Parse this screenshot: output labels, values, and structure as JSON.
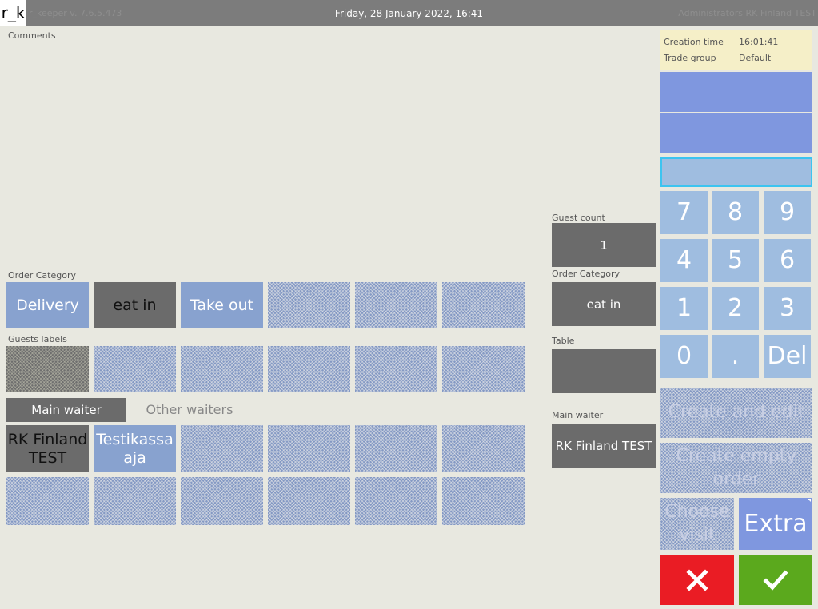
{
  "header": {
    "logo": "r_k",
    "version": "r_keeper v. 7.6.5.473",
    "datetime": "Friday, 28 January 2022, 16:41",
    "user": "Administrators RK Finland TEST"
  },
  "comments_label": "Comments",
  "order_category": {
    "label": "Order Category",
    "options": [
      "Delivery",
      "eat in",
      "Take out"
    ]
  },
  "guests_labels": {
    "label": "Guests labels"
  },
  "waiters": {
    "main_tab": "Main waiter",
    "other_tab": "Other waiters",
    "items": [
      "RK Finland TEST",
      "Testikassa aja"
    ]
  },
  "summary": {
    "guest_count_label": "Guest count",
    "guest_count_value": "1",
    "order_category_label": "Order Category",
    "order_category_value": "eat in",
    "table_label": "Table",
    "table_value": "",
    "main_waiter_label": "Main waiter",
    "main_waiter_value": "RK Finland TEST"
  },
  "info": {
    "creation_time_label": "Creation time",
    "creation_time_value": "16:01:41",
    "trade_group_label": "Trade group",
    "trade_group_value": "Default"
  },
  "keypad": {
    "keys": [
      "7",
      "8",
      "9",
      "4",
      "5",
      "6",
      "1",
      "2",
      "3",
      "0",
      ".",
      "Del"
    ]
  },
  "actions": {
    "create_and_edit": "Create and edit",
    "create_empty_order": "Create empty order",
    "choose_visit": "Choose visit",
    "extra": "Extra",
    "cancel_icon": "close-x-icon",
    "confirm_icon": "check-icon"
  },
  "colors": {
    "accent_blue": "#88a2cf",
    "cancel_red": "#ea1c24",
    "confirm_green": "#5ba91d"
  }
}
